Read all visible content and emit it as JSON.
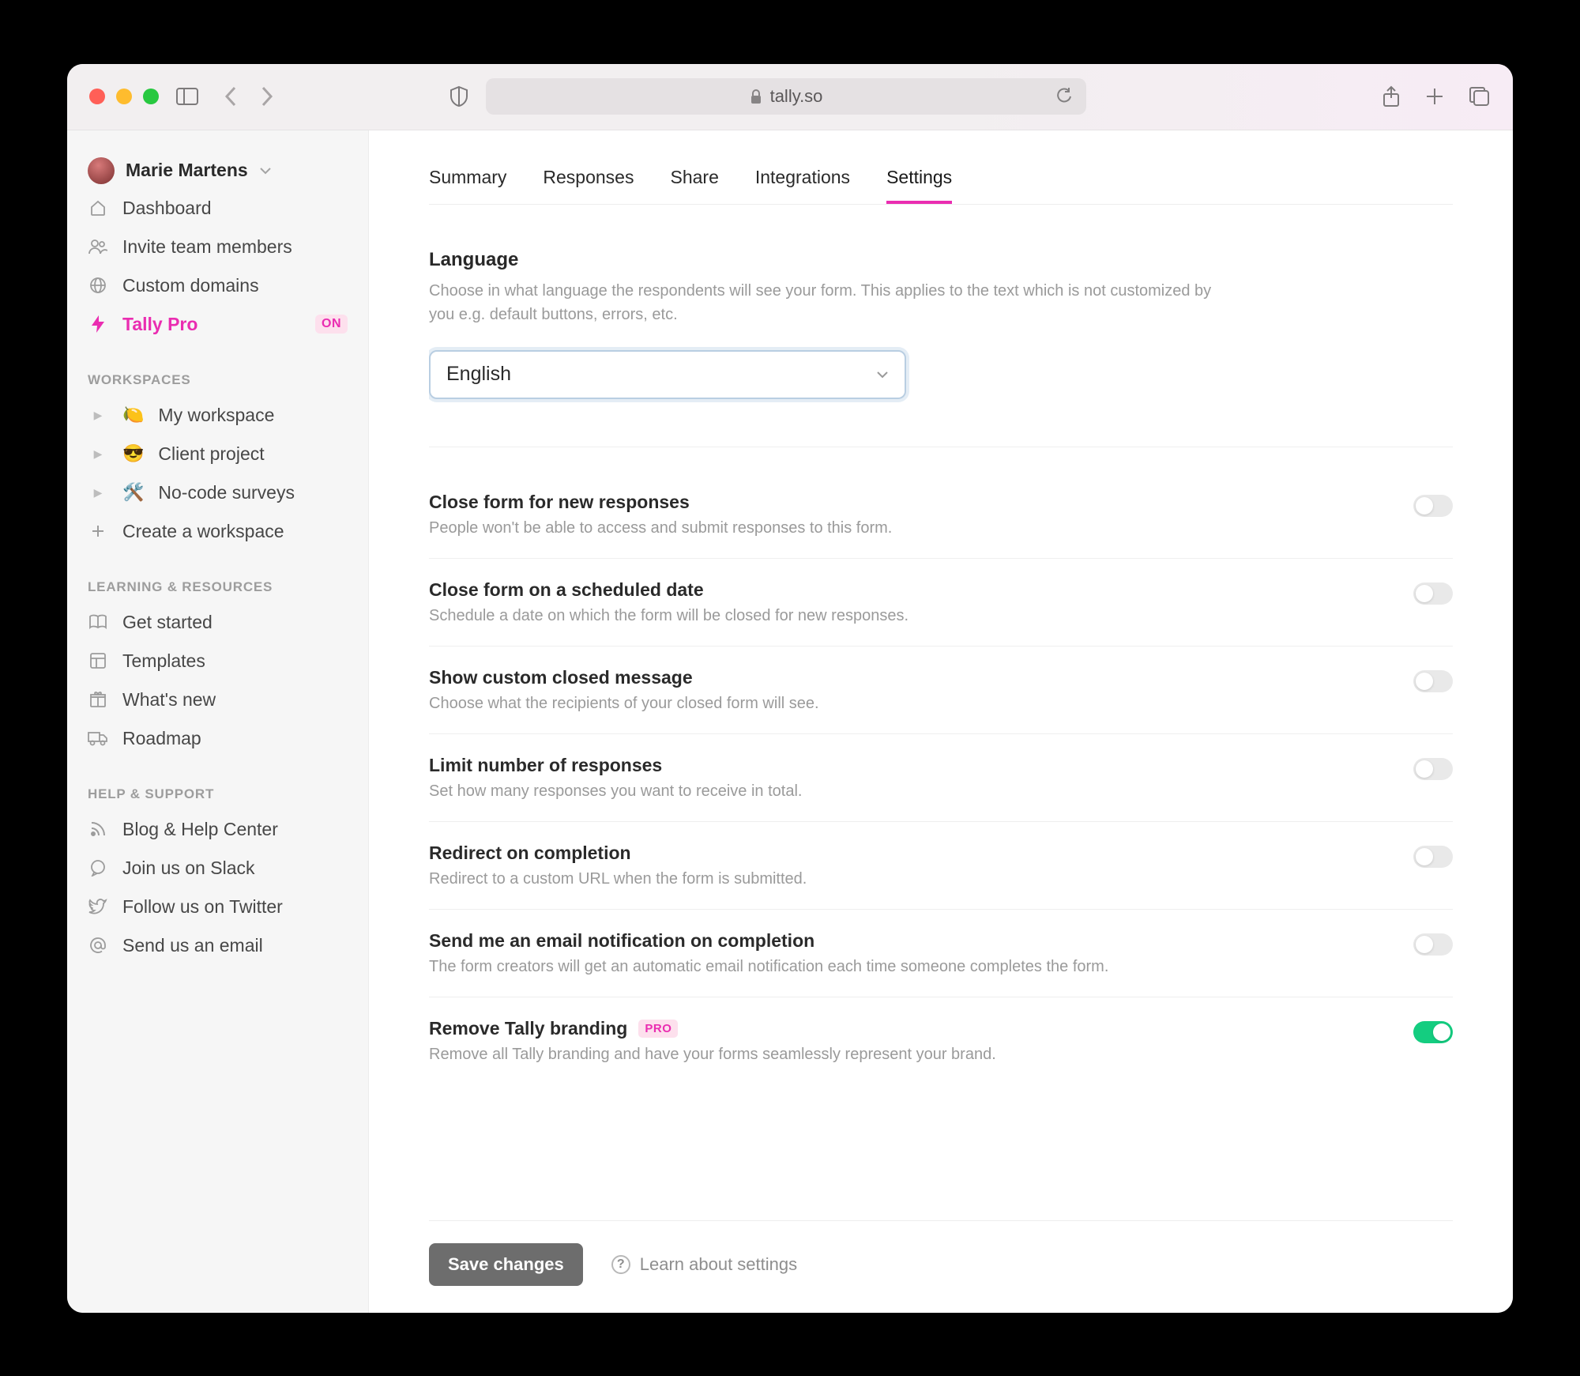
{
  "browser": {
    "url": "tally.so"
  },
  "sidebar": {
    "user_name": "Marie Martens",
    "nav": {
      "dashboard": "Dashboard",
      "invite": "Invite team members",
      "domains": "Custom domains",
      "pro": "Tally Pro",
      "pro_badge": "ON"
    },
    "workspaces_header": "WORKSPACES",
    "workspaces": [
      {
        "emoji": "🍋",
        "label": "My workspace"
      },
      {
        "emoji": "😎",
        "label": "Client project"
      },
      {
        "emoji": "🛠️",
        "label": "No-code surveys"
      }
    ],
    "create_workspace": "Create a workspace",
    "learning_header": "LEARNING & RESOURCES",
    "learning": {
      "get_started": "Get started",
      "templates": "Templates",
      "whats_new": "What's new",
      "roadmap": "Roadmap"
    },
    "help_header": "HELP & SUPPORT",
    "help": {
      "blog": "Blog & Help Center",
      "slack": "Join us on Slack",
      "twitter": "Follow us on Twitter",
      "email": "Send us an email"
    }
  },
  "tabs": {
    "summary": "Summary",
    "responses": "Responses",
    "share": "Share",
    "integrations": "Integrations",
    "settings": "Settings"
  },
  "settings": {
    "language": {
      "title": "Language",
      "desc": "Choose in what language the respondents will see your form. This applies to the text which is not customized by you e.g. default buttons, errors, etc.",
      "value": "English"
    },
    "toggles": [
      {
        "title": "Close form for new responses",
        "desc": "People won't be able to access and submit responses to this form.",
        "on": false
      },
      {
        "title": "Close form on a scheduled date",
        "desc": "Schedule a date on which the form will be closed for new responses.",
        "on": false
      },
      {
        "title": "Show custom closed message",
        "desc": "Choose what the recipients of your closed form will see.",
        "on": false
      },
      {
        "title": "Limit number of responses",
        "desc": "Set how many responses you want to receive in total.",
        "on": false
      },
      {
        "title": "Redirect on completion",
        "desc": "Redirect to a custom URL when the form is submitted.",
        "on": false
      },
      {
        "title": "Send me an email notification on completion",
        "desc": "The form creators will get an automatic email notification each time someone completes the form.",
        "on": false
      },
      {
        "title": "Remove Tally branding",
        "desc": "Remove all Tally branding and have your forms seamlessly represent your brand.",
        "on": true,
        "pro": true
      }
    ],
    "pro_badge": "PRO",
    "save": "Save changes",
    "learn": "Learn about settings"
  }
}
